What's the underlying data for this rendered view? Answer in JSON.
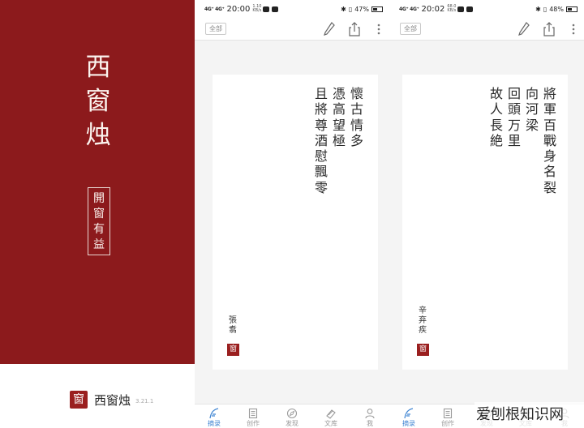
{
  "splash": {
    "title": "西窗烛",
    "motto": "開窗有益",
    "logo_char": "窗",
    "app_name": "西窗烛",
    "version": "3.21.1"
  },
  "phones": [
    {
      "status": {
        "network": "4G⁺ 4G⁺",
        "time": "20:00",
        "speed": "1.10 KB/s",
        "battery": "47%"
      },
      "filter_label": "全部",
      "poem": {
        "columns": [
          "懷古情多",
          "憑高望極",
          "且將尊酒慰飄零"
        ],
        "author": "張翥",
        "seal": "窗"
      },
      "tabs": [
        "摘录",
        "创作",
        "发现",
        "文库",
        "我"
      ]
    },
    {
      "status": {
        "network": "4G⁺ 4G⁺",
        "time": "20:02",
        "speed": "68.0 KB/s",
        "battery": "48%"
      },
      "filter_label": "全部",
      "poem": {
        "columns": [
          "將軍百戰身名裂",
          "向河梁",
          "回頭万里",
          "故人長絶"
        ],
        "author": "辛弃疾",
        "seal": "窗"
      },
      "tabs": [
        "摘录",
        "创作",
        "发现",
        "文库",
        "我"
      ]
    }
  ],
  "watermark": "爱刨根知识网",
  "colors": {
    "splash_red": "#8c1a1c",
    "seal_red": "#9a1f1f",
    "active_tab": "#3e84d2",
    "inactive_tab": "#9a9a9a"
  },
  "icons": {
    "toolbar": [
      "pen-icon",
      "share-icon",
      "more-icon"
    ],
    "tabs": [
      "quill-icon",
      "notebook-icon",
      "compass-icon",
      "books-icon",
      "person-icon"
    ]
  }
}
